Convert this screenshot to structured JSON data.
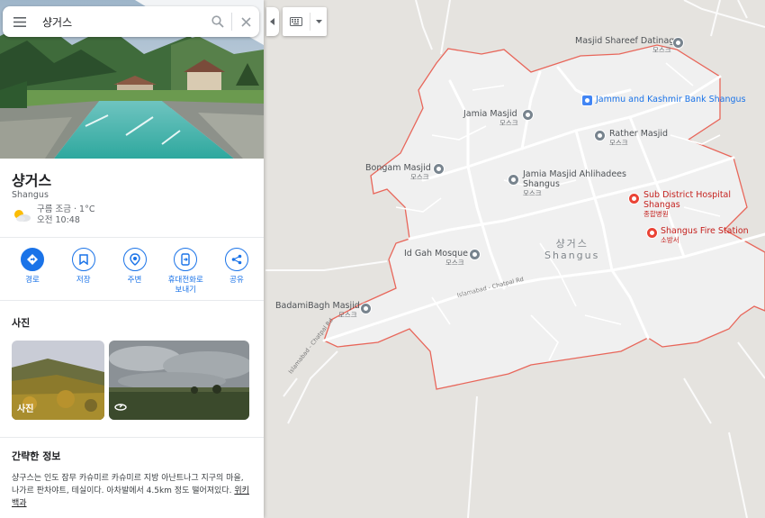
{
  "search": {
    "query": "샹거스"
  },
  "place": {
    "title": "샹거스",
    "subtitle": "Shangus",
    "weather_line1": "구름 조금 · 1°C",
    "weather_line2": "오전 10:48"
  },
  "actions": [
    {
      "label": "경로"
    },
    {
      "label": "저장"
    },
    {
      "label": "주변"
    },
    {
      "label": "휴대전화로 보내기"
    },
    {
      "label": "공유"
    }
  ],
  "photos_section": {
    "heading": "사진",
    "photo1_caption": "사진"
  },
  "about": {
    "heading": "간략한 정보",
    "text": "샹구스는 인도 잠무 카슈미르 카슈미르 지방 아난트나그 지구의 마을, 나가르 판차야트, 테실이다. 아차발에서 4.5km 정도 떨어져있다.",
    "link": "위키백과"
  },
  "map": {
    "town_name_ko": "샹거스",
    "town_name_en": "Shangus",
    "pois": [
      {
        "name": "Masjid Shareef Datinag",
        "sub": "모스크",
        "kind": "gray"
      },
      {
        "name": "Jammu and Kashmir Bank Shangus",
        "sub": "",
        "kind": "blue"
      },
      {
        "name": "Jamia Masjid",
        "sub": "모스크",
        "kind": "gray"
      },
      {
        "name": "Rather Masjid",
        "sub": "모스크",
        "kind": "gray"
      },
      {
        "name": "Bongam Masjid",
        "sub": "모스크",
        "kind": "gray"
      },
      {
        "name": "Jamia Masjid Ahlihadees Shangus",
        "sub": "모스크",
        "kind": "gray"
      },
      {
        "name": "Sub District Hospital Shangas",
        "sub": "종합병원",
        "kind": "red"
      },
      {
        "name": "Shangus Fire Station",
        "sub": "소방서",
        "kind": "red"
      },
      {
        "name": "Id Gah Mosque",
        "sub": "모스크",
        "kind": "gray"
      },
      {
        "name": "BadamiBagh Masjid",
        "sub": "모스크",
        "kind": "gray"
      }
    ],
    "road_labels": [
      "Islamabad - Chatpal Rd",
      "Islamabad - Chatpal Rd"
    ],
    "boundary_color": "#e8665a"
  }
}
